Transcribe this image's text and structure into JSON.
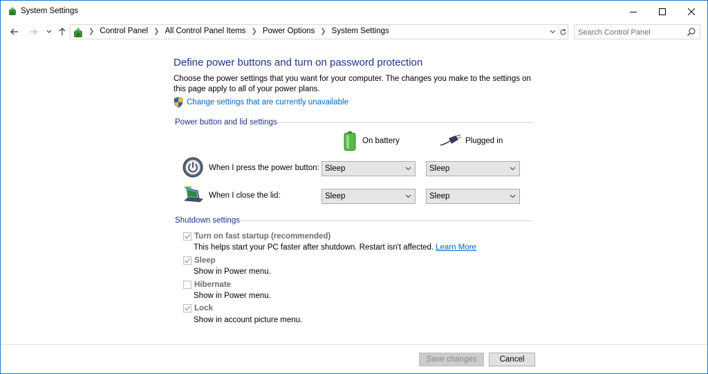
{
  "window": {
    "title": "System Settings"
  },
  "navigation": {
    "breadcrumbs": [
      "Control Panel",
      "All Control Panel Items",
      "Power Options",
      "System Settings"
    ],
    "search_placeholder": "Search Control Panel"
  },
  "page": {
    "heading": "Define power buttons and turn on password protection",
    "description": "Choose the power settings that you want for your computer. The changes you make to the settings on this page apply to all of your power plans.",
    "elevate_link": "Change settings that are currently unavailable"
  },
  "power_section": {
    "title": "Power button and lid settings",
    "col_battery": "On battery",
    "col_plugged": "Plugged in",
    "rows": [
      {
        "label": "When I press the power button:",
        "battery": "Sleep",
        "plugged": "Sleep"
      },
      {
        "label": "When I close the lid:",
        "battery": "Sleep",
        "plugged": "Sleep"
      }
    ]
  },
  "shutdown_section": {
    "title": "Shutdown settings",
    "items": [
      {
        "label": "Turn on fast startup (recommended)",
        "desc": "This helps start your PC faster after shutdown. Restart isn't affected.",
        "link": "Learn More",
        "checked": true
      },
      {
        "label": "Sleep",
        "desc": "Show in Power menu.",
        "checked": true
      },
      {
        "label": "Hibernate",
        "desc": "Show in Power menu.",
        "checked": false
      },
      {
        "label": "Lock",
        "desc": "Show in account picture menu.",
        "checked": true
      }
    ]
  },
  "footer": {
    "save_label": "Save changes",
    "cancel_label": "Cancel"
  },
  "colors": {
    "accent_border": "#1b78d6",
    "heading": "#1e3287",
    "link": "#0066cc"
  },
  "icons": {
    "app": "control-panel-icon",
    "search": "search-icon",
    "shield": "uac-shield-icon",
    "battery": "battery-icon",
    "plug": "plug-icon",
    "power_button": "power-button-icon",
    "lid": "laptop-lid-icon"
  }
}
